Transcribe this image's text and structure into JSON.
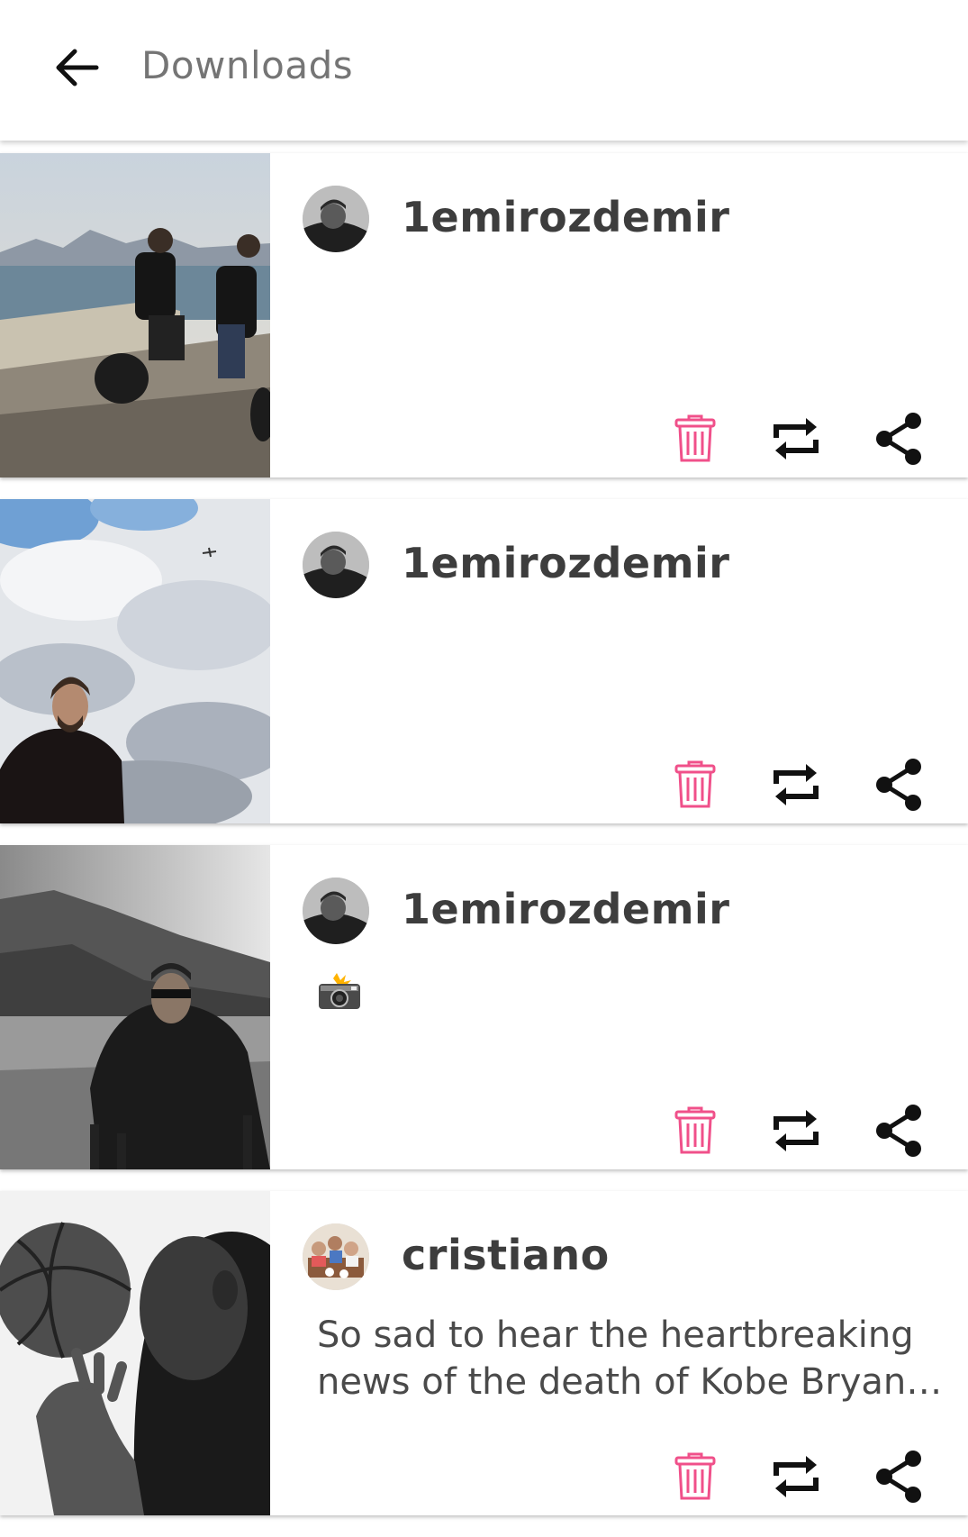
{
  "appbar": {
    "title": "Downloads",
    "back_icon": "arrow-left-icon"
  },
  "colors": {
    "accent_delete": "#f0508a",
    "text_primary": "#3d3d3d",
    "text_secondary": "#757575",
    "icon_dark": "#111111"
  },
  "posts": [
    {
      "username": "1emirozdemir",
      "caption": "",
      "media": "photo-two-men-on-scooters-by-sea"
    },
    {
      "username": "1emirozdemir",
      "caption": "",
      "media": "photo-man-under-cloudy-sky"
    },
    {
      "username": "1emirozdemir",
      "caption": "📸",
      "media": "photo-bw-man-by-lake-mountains"
    },
    {
      "username": "cristiano",
      "caption": "So sad to hear the heartbreaking news of the death of Kobe Bryant and his daughter Gianna. Kobe was a true legend and an inspiration to so many.",
      "media": "photo-bw-man-with-basketball"
    }
  ],
  "actions": {
    "delete_icon": "trash-icon",
    "repost_icon": "repost-icon",
    "share_icon": "share-icon"
  }
}
